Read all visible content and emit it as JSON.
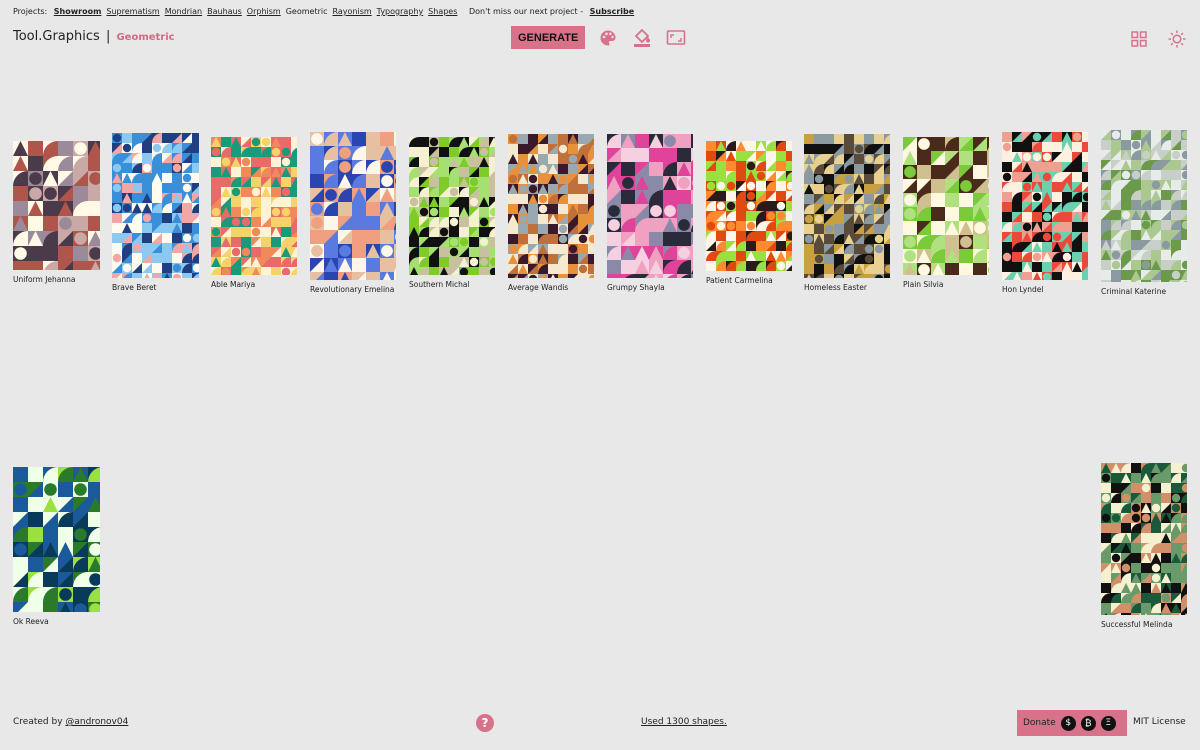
{
  "projects": {
    "prefix": "Projects:",
    "links": [
      {
        "label": "Showroom",
        "style": "active"
      },
      {
        "label": "Suprematism",
        "style": "link"
      },
      {
        "label": "Mondrian",
        "style": "link"
      },
      {
        "label": "Bauhaus",
        "style": "link"
      },
      {
        "label": "Orphism",
        "style": "link"
      },
      {
        "label": "Geometric",
        "style": "plain"
      },
      {
        "label": "Rayonism",
        "style": "link"
      },
      {
        "label": "Typography",
        "style": "link"
      },
      {
        "label": "Shapes",
        "style": "link"
      }
    ],
    "promo": "Don't miss our next project -",
    "subscribe": "Subscribe"
  },
  "brand": {
    "name": "Tool.Graphics",
    "separator": "|",
    "mode": "Geometric"
  },
  "toolbar": {
    "generate_label": "GENERATE",
    "icons": [
      "palette-icon",
      "paint-bucket-icon",
      "aspect-ratio-icon"
    ],
    "right_icons": [
      "grid-view-icon",
      "theme-toggle-icon"
    ]
  },
  "accent_color": "#d8728a",
  "cards": [
    {
      "name": "Uniform Jehanna",
      "colors": [
        "#b0554c",
        "#4a3a4a",
        "#c9a9a6",
        "#fff9e6",
        "#9a8a9a"
      ]
    },
    {
      "name": "Brave Beret",
      "colors": [
        "#3a8fd8",
        "#f4a6a6",
        "#fffbee",
        "#1f3f80",
        "#8cc9f0"
      ]
    },
    {
      "name": "Able Mariya",
      "colors": [
        "#1a9a7a",
        "#f18a5a",
        "#f5d36a",
        "#e86a6a",
        "#fff3d6"
      ]
    },
    {
      "name": "Revolutionary Emelina",
      "colors": [
        "#2a45b0",
        "#f0a080",
        "#fff6ea",
        "#e6c0a0",
        "#5a7ae0"
      ]
    },
    {
      "name": "Southern Michal",
      "colors": [
        "#7ecb2a",
        "#111111",
        "#c9c0a0",
        "#a6e070",
        "#f5f0d0"
      ]
    },
    {
      "name": "Average Wandis",
      "colors": [
        "#e8903a",
        "#3a1a2a",
        "#9aa8b0",
        "#f5ead0",
        "#c0703a"
      ]
    },
    {
      "name": "Grumpy Shayla",
      "colors": [
        "#e0449a",
        "#8a8aa8",
        "#2a2a3a",
        "#f5d0e0",
        "#f0a0c0"
      ]
    },
    {
      "name": "Patient Carmelina",
      "colors": [
        "#e04a10",
        "#2a1a1a",
        "#9ae040",
        "#ff8a30",
        "#fff5e8"
      ]
    },
    {
      "name": "Homeless Easter",
      "colors": [
        "#c8a040",
        "#111111",
        "#8a9aa0",
        "#e8d090",
        "#5a4a3a"
      ]
    },
    {
      "name": "Plain Silvia",
      "colors": [
        "#7aca3a",
        "#fff8e0",
        "#4a2a1a",
        "#b0e080",
        "#d0c090"
      ]
    },
    {
      "name": "Hon Lyndel",
      "colors": [
        "#ea4a3a",
        "#111111",
        "#6ad0b0",
        "#f0a090",
        "#fff0e0"
      ]
    },
    {
      "name": "Criminal Katerine",
      "colors": [
        "#6a9a4a",
        "#c8cfc8",
        "#e8ece8",
        "#8a9aa0",
        "#aac890"
      ]
    },
    {
      "name": "Ok Reeva",
      "colors": [
        "#2a7a2a",
        "#1a5a9a",
        "#9ae040",
        "#f0ffe8",
        "#0a3a5a"
      ]
    },
    {
      "name": "Successful Melinda",
      "colors": [
        "#1a5a3a",
        "#f5f0d0",
        "#d0906a",
        "#111111",
        "#6a9a6a"
      ]
    }
  ],
  "footer": {
    "created_by": "Created by",
    "handle": "@andronov04",
    "help_symbol": "?",
    "shapes_text": "Used 1300 shapes.",
    "donate_label": "Donate",
    "coins": [
      "$",
      "₿",
      "Ξ"
    ],
    "license": "MIT License"
  }
}
